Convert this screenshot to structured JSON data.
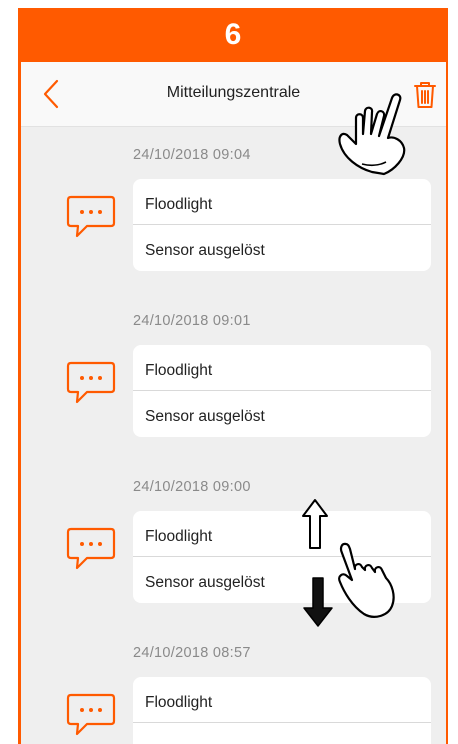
{
  "step": {
    "number": "6"
  },
  "header": {
    "title": "Mitteilungszentrale",
    "back_icon": "chevron-left-icon",
    "delete_icon": "trash-icon"
  },
  "colors": {
    "accent": "#ff5a00",
    "background": "#efefef",
    "card": "#ffffff"
  },
  "notifications": [
    {
      "timestamp": "24/10/2018 09:04",
      "title": "Floodlight",
      "message": "Sensor ausgelöst"
    },
    {
      "timestamp": "24/10/2018 09:01",
      "title": "Floodlight",
      "message": "Sensor ausgelöst"
    },
    {
      "timestamp": "24/10/2018 09:00",
      "title": "Floodlight",
      "message": "Sensor ausgelöst"
    },
    {
      "timestamp": "24/10/2018 08:57",
      "title": "Floodlight",
      "message": ""
    }
  ]
}
